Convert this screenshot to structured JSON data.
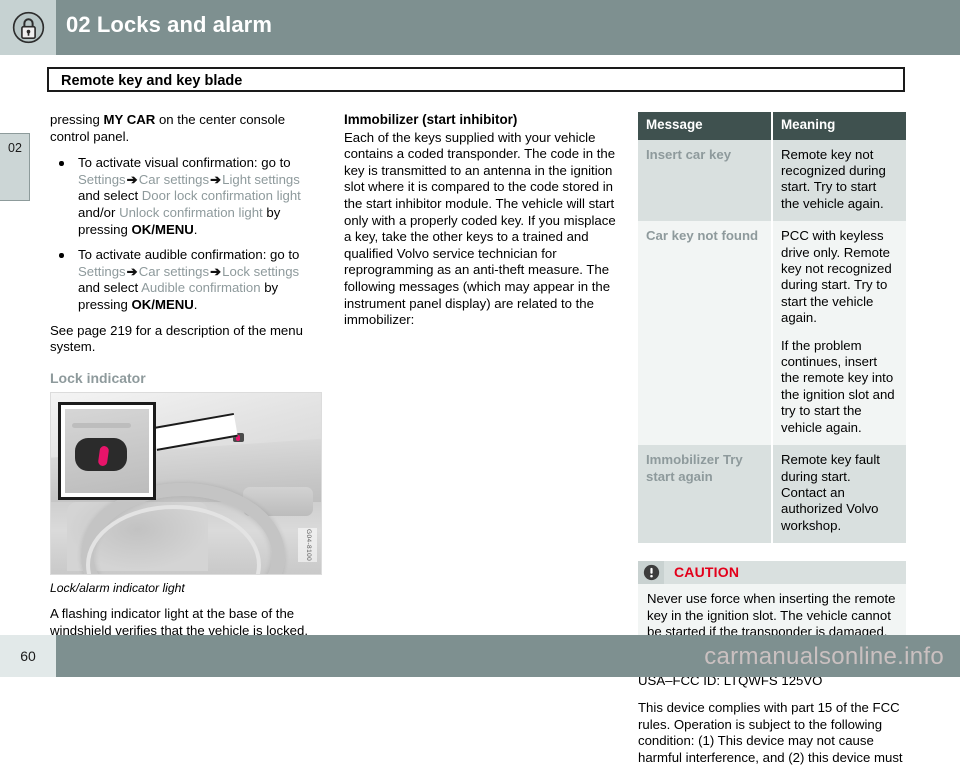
{
  "header": {
    "chapter_title": "02 Locks and alarm",
    "icon": "padlock-icon"
  },
  "section": {
    "title": "Remote key and key blade"
  },
  "chapter_tab": {
    "number": "02"
  },
  "left_column": {
    "intro_lead": "pressing ",
    "intro_bold": "MY CAR",
    "intro_tail": " on the center console control panel.",
    "bullets": [
      {
        "lead": "To activate visual confirmation: go to ",
        "path1": "Settings",
        "arrow1": "➔",
        "path2": "Car settings",
        "arrow2": "➔",
        "path3": "Light settings",
        "mid1": " and select ",
        "opt1": "Door lock confirmation light",
        "mid2": " and/or ",
        "opt2": "Unlock confirmation light",
        "mid3": " by pressing ",
        "key": "OK/MENU",
        "tail": "."
      },
      {
        "lead": "To activate audible confirmation: go to ",
        "path1": "Settings",
        "arrow1": "➔",
        "path2": "Car settings",
        "arrow2": "➔",
        "path3": "Lock settings",
        "mid1": " and select ",
        "opt1": "Audible confirmation",
        "mid2": "",
        "opt2": "",
        "mid3": " by pressing ",
        "key": "OK/MENU",
        "tail": "."
      }
    ],
    "see_page": "See page 219 for a description of the menu system.",
    "subheading": "Lock indicator",
    "figure": {
      "image_code": "G04-8100",
      "caption": "Lock/alarm indicator light"
    },
    "after_figure": "A flashing indicator light at the base of the windshield verifies that the vehicle is locked."
  },
  "middle_column": {
    "heading": "Immobilizer (start inhibitor)",
    "body": "Each of the keys supplied with your vehicle contains a coded transponder. The code in the key is transmitted to an antenna in the ignition slot where it is compared to the code stored in the start inhibitor module. The vehicle will start only with a properly coded key. If you misplace a key, take the other keys to a trained and qualified Volvo service technician for reprogramming as an anti-theft measure. The following messages (which may appear in the instrument panel display) are related to the immobilizer:"
  },
  "table": {
    "columns": [
      "Message",
      "Meaning"
    ],
    "rows": [
      {
        "message": "Insert car key",
        "meaning": [
          "Remote key not recognized during start. Try to start the vehicle again."
        ]
      },
      {
        "message": "Car key not found",
        "meaning": [
          "PCC with keyless drive only. Remote key not recognized during start. Try to start the vehicle again.",
          "If the problem continues, insert the remote key into the ignition slot and try to start the vehicle again."
        ]
      },
      {
        "message": "Immobilizer Try start again",
        "meaning": [
          "Remote key fault during start. Contact an authorized Volvo workshop."
        ]
      }
    ]
  },
  "caution": {
    "title": "CAUTION",
    "icon": "exclamation-circle-icon",
    "body": "Never use force when inserting the remote key in the ignition slot. The vehicle cannot be started if the transponder is damaged."
  },
  "fcc": {
    "id_line": "USA–FCC ID: LTQWFS 125VO",
    "body": "This device complies with part 15 of the FCC rules. Operation is subject to the following condition: (1) This device may not cause harmful interference, and (2) this device must"
  },
  "footer": {
    "page_number": "60",
    "watermark": "carmanualsonline.info"
  },
  "colors": {
    "header_band": "#7e9090",
    "table_header": "#3f514f",
    "menu_text": "#8e9a9c",
    "caution_red": "#e3001b",
    "indicator_pink": "#e8146a"
  }
}
